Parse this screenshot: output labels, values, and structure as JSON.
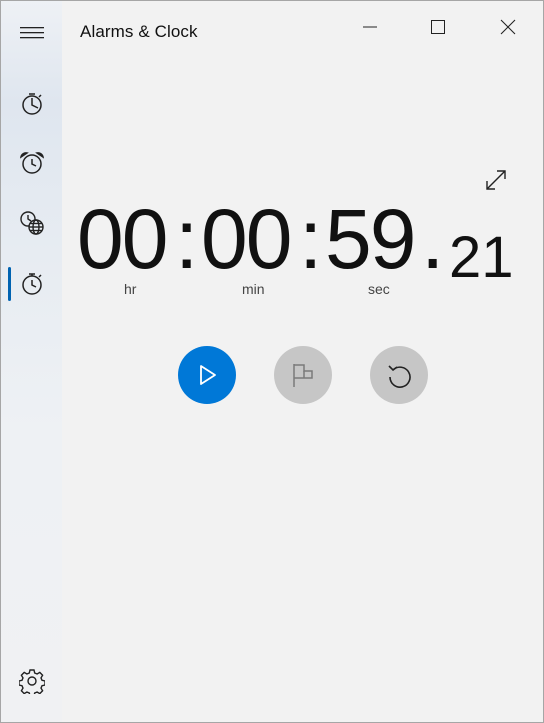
{
  "window": {
    "title": "Alarms & Clock"
  },
  "sidebar": {
    "items": [
      {
        "name": "menu",
        "icon": "hamburger-menu-icon"
      },
      {
        "name": "timer",
        "icon": "timer-icon"
      },
      {
        "name": "alarm",
        "icon": "alarm-clock-icon"
      },
      {
        "name": "world-clock",
        "icon": "world-clock-icon"
      },
      {
        "name": "stopwatch",
        "icon": "stopwatch-icon",
        "active": true
      },
      {
        "name": "settings",
        "icon": "gear-icon"
      }
    ]
  },
  "stopwatch": {
    "hours": "00",
    "sep1": ":",
    "minutes": "00",
    "sep2": ":",
    "seconds": "59",
    "dot": ".",
    "hundredths": "21",
    "unit_hr": "hr",
    "unit_min": "min",
    "unit_sec": "sec"
  },
  "colors": {
    "accent": "#0078d7",
    "button_disabled": "#c6c6c6",
    "active_indicator": "#0063b1"
  }
}
